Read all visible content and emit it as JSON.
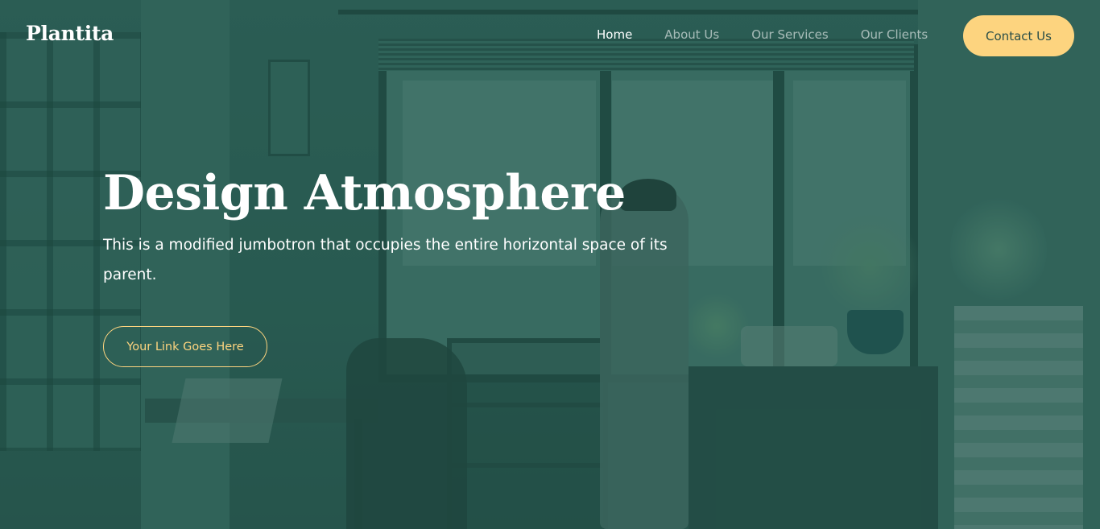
{
  "navbar": {
    "brand": "Plantita",
    "links": [
      {
        "label": "Home",
        "active": true
      },
      {
        "label": "About Us",
        "active": false
      },
      {
        "label": "Our Services",
        "active": false
      },
      {
        "label": "Our Clients",
        "active": false
      }
    ],
    "cta_label": "Contact Us"
  },
  "hero": {
    "title": "Design Atmosphere",
    "subtitle": "This is a modified jumbotron that occupies the entire horizontal space of its parent.",
    "link_label": "Your Link Goes Here"
  },
  "colors": {
    "overlay": "#2f5d55",
    "accent": "#fdd47f",
    "text": "#ffffff"
  }
}
